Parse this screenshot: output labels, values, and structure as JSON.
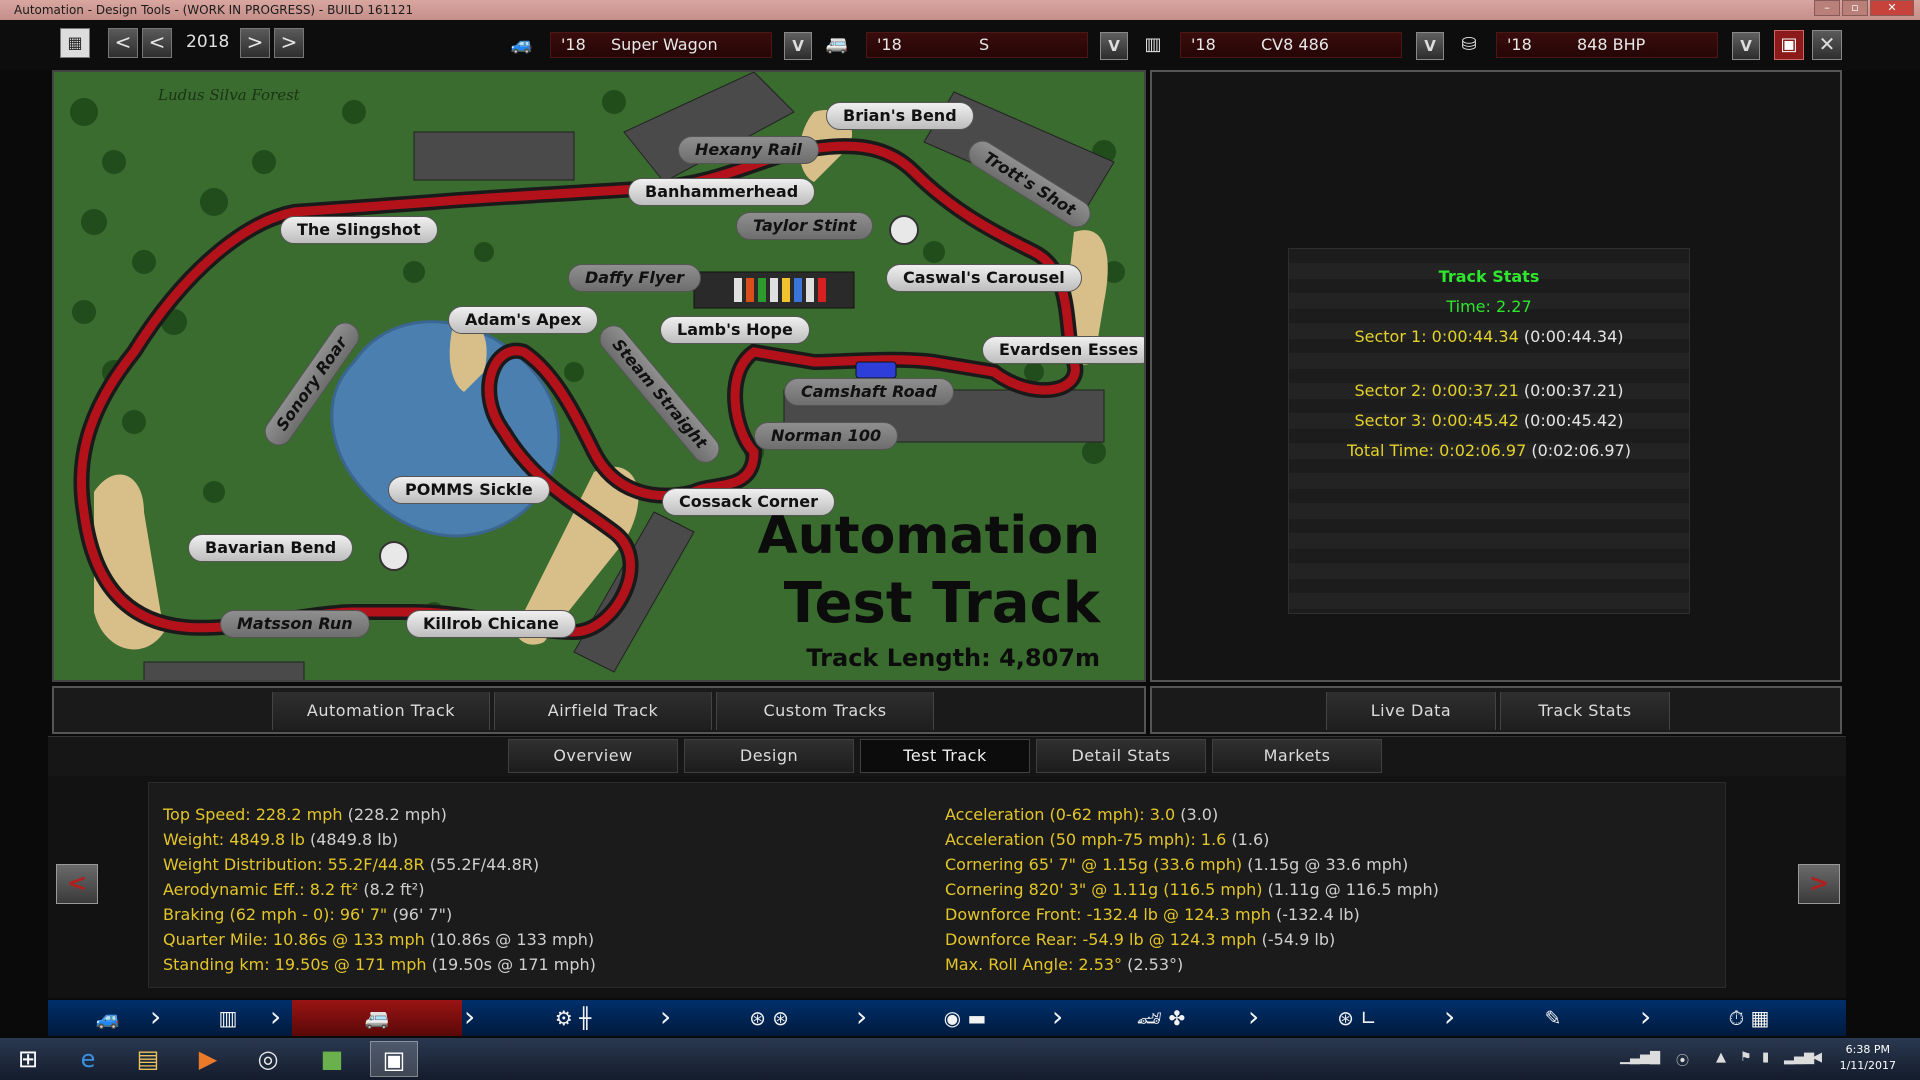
{
  "window": {
    "title": "Automation - Design Tools - (WORK IN PROGRESS) - BUILD 161121",
    "min": "–",
    "max": "▫",
    "close": "✕"
  },
  "toolbar": {
    "prev2": "<",
    "prev": "<",
    "year": "2018",
    "next": ">",
    "next2": ">",
    "model": {
      "year": "'18",
      "name": "Super Wagon"
    },
    "trim": {
      "year": "'18",
      "name": "S"
    },
    "engine": {
      "year": "'18",
      "name": "CV8 486"
    },
    "engine_variant": {
      "year": "'18",
      "name": "848 BHP"
    },
    "dropdown_label": "V",
    "save": "💾",
    "close": "✕"
  },
  "map": {
    "forest": "Ludus Silva Forest",
    "title_line1": "Automation",
    "title_line2": "Test Track",
    "length": "Track Length: 4,807m",
    "corners": [
      "Brian's Bend",
      "Hexany Rail",
      "Trott's Shot",
      "Banhammerhead",
      "Taylor Stint",
      "The Slingshot",
      "Daffy Flyer",
      "Caswal's Carousel",
      "Adam's Apex",
      "Lamb's Hope",
      "Evardsen Esses",
      "Sonory Roar",
      "Steam Straight",
      "Camshaft Road",
      "Norman 100",
      "POMMS Sickle",
      "Cossack Corner",
      "Bavarian Bend",
      "Matsson Run",
      "Killrob Chicane"
    ]
  },
  "track_stats": {
    "title": "Track Stats",
    "time": "Time: 2.27",
    "sector1": "Sector 1: 0:00:44.34",
    "sector1_ref": "(0:00:44.34)",
    "sector2": "Sector 2: 0:00:37.21",
    "sector2_ref": "(0:00:37.21)",
    "sector3": "Sector 3: 0:00:45.42",
    "sector3_ref": "(0:00:45.42)",
    "total": "Total Time: 0:02:06.97",
    "total_ref": "(0:02:06.97)"
  },
  "track_tabs": [
    "Automation Track",
    "Airfield Track",
    "Custom Tracks"
  ],
  "data_tabs": [
    "Live Data",
    "Track Stats"
  ],
  "main_tabs": [
    "Overview",
    "Design",
    "Test Track",
    "Detail Stats",
    "Markets"
  ],
  "stats_left": [
    {
      "k": "Top Speed: 228.2 mph",
      "v": "(228.2 mph)"
    },
    {
      "k": "Weight: 4849.8 lb",
      "v": "(4849.8 lb)"
    },
    {
      "k": "Weight Distribution: 55.2F/44.8R",
      "v": "(55.2F/44.8R)"
    },
    {
      "k": "Aerodynamic Eff.: 8.2 ft²",
      "v": "(8.2 ft²)"
    },
    {
      "k": "Braking (62 mph - 0): 96' 7\"",
      "v": "(96' 7\")"
    },
    {
      "k": "Quarter Mile: 10.86s @ 133 mph",
      "v": "(10.86s @ 133 mph)"
    },
    {
      "k": "Standing km: 19.50s @ 171 mph",
      "v": "(19.50s @ 171 mph)"
    }
  ],
  "stats_right": [
    {
      "k": "Acceleration (0-62 mph): 3.0",
      "v": "(3.0)"
    },
    {
      "k": "Acceleration (50 mph-75 mph): 1.6",
      "v": "(1.6)"
    },
    {
      "k": "Cornering 65' 7\" @ 1.15g (33.6 mph)",
      "v": "(1.15g @ 33.6 mph)"
    },
    {
      "k": "Cornering 820' 3\" @ 1.11g (116.5 mph)",
      "v": "(1.11g @ 116.5 mph)"
    },
    {
      "k": "Downforce Front: -132.4 lb @ 124.3 mph",
      "v": "(-132.4 lb)"
    },
    {
      "k": "Downforce Rear: -54.9 lb @ 124.3 mph",
      "v": "(-54.9 lb)"
    },
    {
      "k": "Max. Roll Angle: 2.53°",
      "v": "(2.53°)"
    }
  ],
  "nav_arrows": {
    "left": "<",
    "right": ">"
  },
  "bottom_nav": {
    "icons": [
      "car-body-icon",
      "engine-icon",
      "trim-icon",
      "suspension-gearbox-icon",
      "wheels-icon",
      "brakes-body-icon",
      "car-aero-fan-icon",
      "interior-seat-icon",
      "tuning-icon",
      "test-track-icon"
    ]
  },
  "taskbar": {
    "time": "6:38 PM",
    "date": "1/11/2017",
    "apps": [
      "windows-start-icon",
      "internet-explorer-icon",
      "file-explorer-icon",
      "media-player-icon",
      "chrome-icon",
      "minecraft-icon",
      "automation-app-icon"
    ]
  },
  "colors": {
    "track_red": "#b3121a",
    "grass": "#3a6b2f",
    "accent_yellow": "#e3c52a",
    "accent_green": "#2ee62e",
    "nav_blue": "#002f6b"
  }
}
